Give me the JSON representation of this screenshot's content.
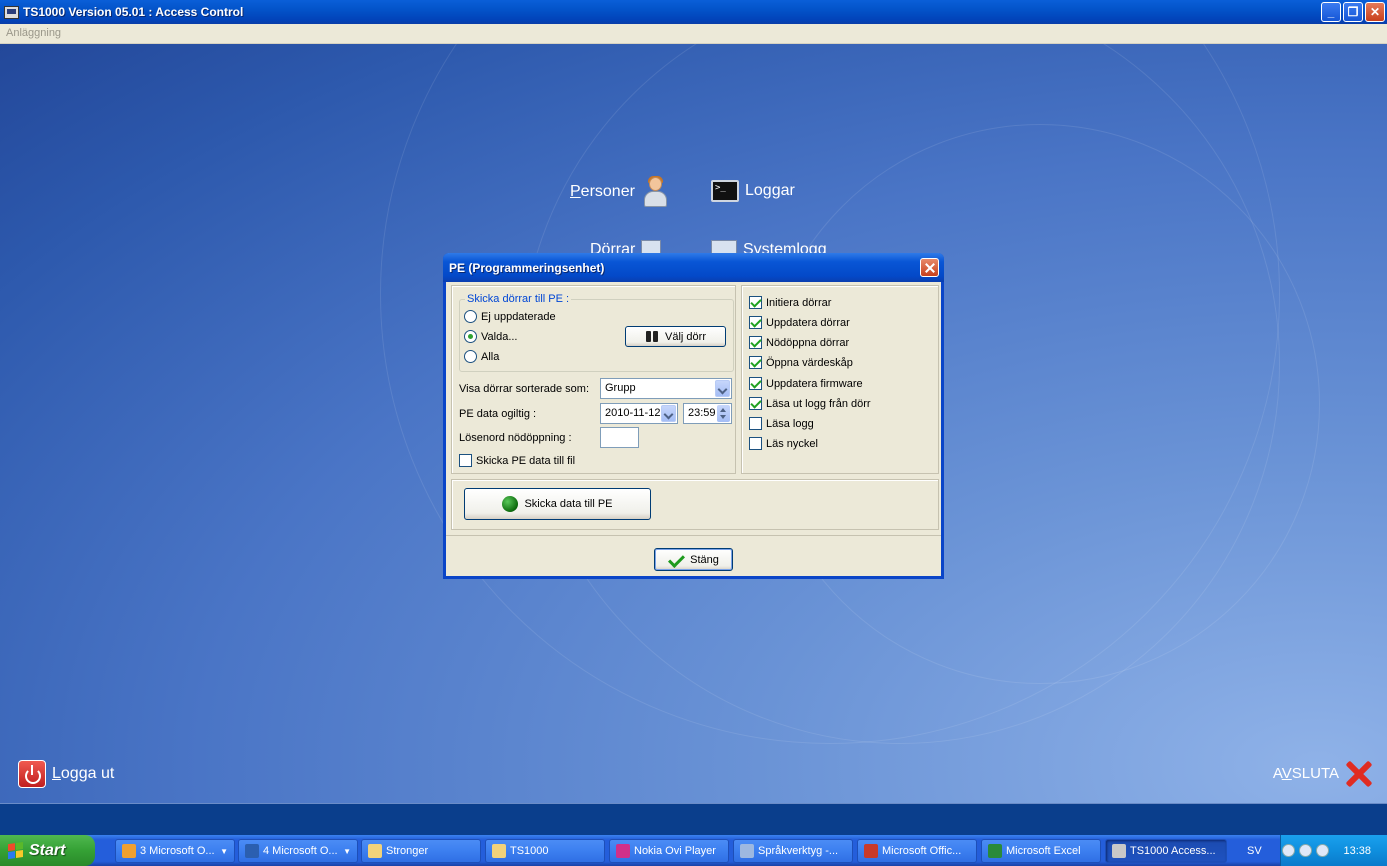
{
  "window": {
    "title": "TS1000 Version 05.01 : Access Control",
    "minimize_label": "_",
    "restore_label": "❐",
    "close_label": "✕"
  },
  "menu": {
    "items": [
      "Anläggning"
    ]
  },
  "nav": {
    "personer_first": "P",
    "personer_rest": "ersoner",
    "loggar": "Loggar",
    "dorrar_partial": "Dörrar",
    "systemlogg_partial": "Systemlogg"
  },
  "footer": {
    "logout_first": "L",
    "logout_rest": "ogga ut",
    "exit_a": "A",
    "exit_v": "V",
    "exit_rest": "SLUTA"
  },
  "dialog": {
    "title": "PE (Programmeringsenhet)",
    "group_legend": "Skicka dörrar till PE :",
    "radios": [
      {
        "label": "Ej uppdaterade",
        "selected": false
      },
      {
        "label": "Valda...",
        "selected": true
      },
      {
        "label": "Alla",
        "selected": false
      }
    ],
    "select_door_label": "Välj dörr",
    "sort_label": "Visa dörrar sorterade som:",
    "sort_value": "Grupp",
    "invalid_label": "PE data ogiltig :",
    "invalid_date": "2010-11-12",
    "invalid_time": "23:59",
    "password_label": "Lösenord nödöppning :",
    "password_value": "",
    "send_to_file_label": "Skicka PE data till fil",
    "send_to_file_checked": false,
    "options": [
      {
        "label": "Initiera dörrar",
        "checked": true
      },
      {
        "label": "Uppdatera dörrar",
        "checked": true
      },
      {
        "label": "Nödöppna dörrar",
        "checked": true
      },
      {
        "label": "Öppna värdeskåp",
        "checked": true
      },
      {
        "label": "Uppdatera firmware",
        "checked": true
      },
      {
        "label": "Läsa ut logg från dörr",
        "checked": true
      },
      {
        "label": "Läsa logg",
        "checked": false
      },
      {
        "label": "Läs nyckel",
        "checked": false
      }
    ],
    "send_button_label": "Skicka data till PE",
    "close_button_label": "Stäng"
  },
  "taskbar": {
    "start_label": "Start",
    "tasks": [
      {
        "label": "3 Microsoft O...",
        "has_arrow": true,
        "icon_color": "#f0a030"
      },
      {
        "label": "4 Microsoft O...",
        "has_arrow": true,
        "icon_color": "#2b5fb0"
      },
      {
        "label": "Stronger",
        "has_arrow": false,
        "icon_color": "#f2d27a"
      },
      {
        "label": "TS1000",
        "has_arrow": false,
        "icon_color": "#f2d27a"
      },
      {
        "label": "Nokia Ovi Player",
        "has_arrow": false,
        "icon_color": "#d0308a"
      },
      {
        "label": "Språkverktyg -...",
        "has_arrow": false,
        "icon_color": "#9db8e0"
      },
      {
        "label": "Microsoft Offic...",
        "has_arrow": false,
        "icon_color": "#c83a2a"
      },
      {
        "label": "Microsoft Excel",
        "has_arrow": false,
        "icon_color": "#2a8a3a"
      },
      {
        "label": "TS1000 Access...",
        "has_arrow": false,
        "icon_color": "#c8c8c8",
        "active": true
      }
    ],
    "language": "SV",
    "clock": "13:38"
  },
  "colors": {
    "titlebar": "#0353c9",
    "dialog_bg": "#ece9d8",
    "taskbar": "#245edb",
    "start": "#35a135"
  }
}
